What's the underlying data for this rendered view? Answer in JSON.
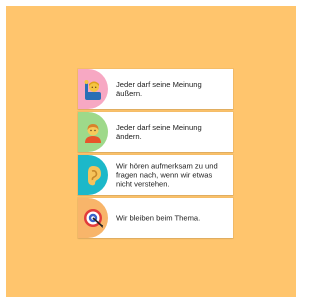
{
  "colors": {
    "background": "#ffc56d",
    "card": "#ffffff",
    "badge_pink": "#f7a8c3",
    "badge_green": "#9ed98a",
    "badge_teal": "#1cb8c9",
    "badge_orange": "#f8b56a"
  },
  "rules": [
    {
      "icon": "person-raising-hand-icon",
      "text": "Jeder darf seine Meinung äußern."
    },
    {
      "icon": "person-icon",
      "text": "Jeder darf seine Meinung ändern."
    },
    {
      "icon": "ear-icon",
      "text": "Wir hören aufmerksam zu und fragen nach, wenn wir etwas nicht verstehen."
    },
    {
      "icon": "target-icon",
      "text": "Wir bleiben beim Thema."
    }
  ]
}
